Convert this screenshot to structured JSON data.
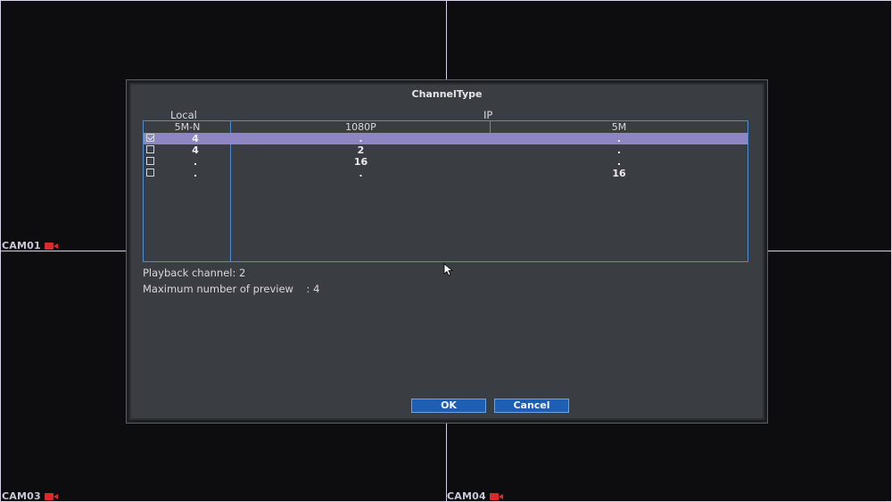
{
  "cameras": [
    {
      "label": "CAM01"
    },
    {
      "label": "CAM03"
    },
    {
      "label": "CAM04"
    }
  ],
  "dialog": {
    "title": "ChannelType",
    "group_local": "Local",
    "group_ip": "IP",
    "columns": [
      "5M-N",
      "1080P",
      "5M"
    ],
    "rows": [
      {
        "checked": true,
        "local": "4",
        "p1080": ".",
        "m5": "."
      },
      {
        "checked": false,
        "local": "4",
        "p1080": "2",
        "m5": "."
      },
      {
        "checked": false,
        "local": ".",
        "p1080": "16",
        "m5": "."
      },
      {
        "checked": false,
        "local": ".",
        "p1080": ".",
        "m5": "16"
      }
    ],
    "playback_channel": "Playback channel: 2",
    "max_preview": "Maximum number of preview    : 4",
    "ok_label": "OK",
    "cancel_label": "Cancel"
  },
  "colors": {
    "selected_row": "#8e86c2",
    "table_border": "#4d8fd6",
    "button_bg": "#1e5fb4",
    "record_icon": "#d92b2b"
  }
}
